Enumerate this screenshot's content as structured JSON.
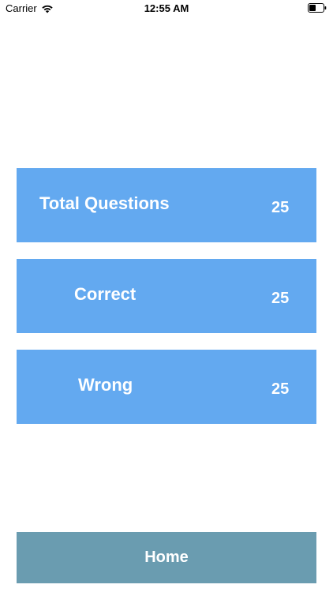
{
  "status_bar": {
    "carrier": "Carrier",
    "time": "12:55 AM",
    "wifi_icon": "wifi-icon",
    "battery_icon": "battery-icon"
  },
  "results": [
    {
      "label": "Total Questions",
      "value": "25"
    },
    {
      "label": "Correct",
      "value": "25"
    },
    {
      "label": "Wrong",
      "value": "25"
    }
  ],
  "home_button": {
    "label": "Home"
  },
  "colors": {
    "card_background": "#63a9f0",
    "home_button_background": "#6a9cb0",
    "text_on_color": "#ffffff"
  }
}
